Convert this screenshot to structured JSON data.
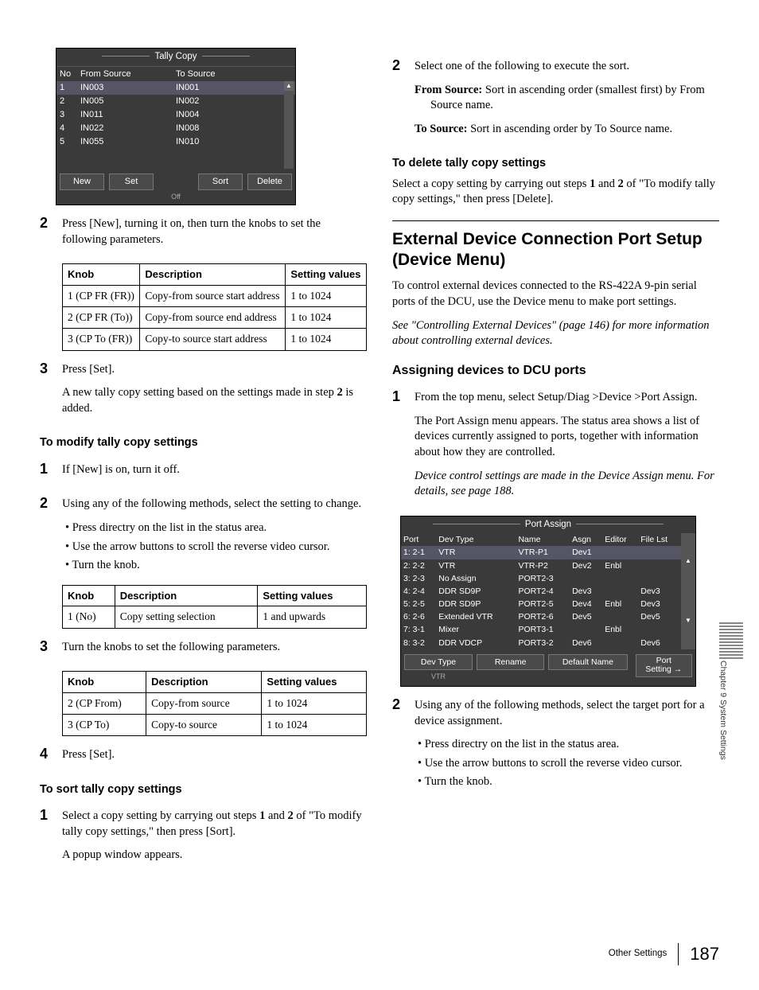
{
  "tally_panel": {
    "title": "Tally Copy",
    "headers": {
      "no": "No",
      "from": "From Source",
      "to": "To Source"
    },
    "rows": [
      {
        "no": "1",
        "from": "IN003",
        "to": "IN001"
      },
      {
        "no": "2",
        "from": "IN005",
        "to": "IN002"
      },
      {
        "no": "3",
        "from": "IN011",
        "to": "IN004"
      },
      {
        "no": "4",
        "from": "IN022",
        "to": "IN008"
      },
      {
        "no": "5",
        "from": "IN055",
        "to": "IN010"
      }
    ],
    "buttons": {
      "new": "New",
      "set": "Set",
      "sort": "Sort",
      "delete": "Delete"
    },
    "sub_off": "Off"
  },
  "left": {
    "step2a": "Press [New], turning it on, then turn the knobs to set the following parameters.",
    "table1": {
      "h1": "Knob",
      "h2": "Description",
      "h3": "Setting values",
      "r1": {
        "a": "1 (CP FR (FR))",
        "b": "Copy-from source start address",
        "c": "1 to 1024"
      },
      "r2": {
        "a": "2 (CP FR (To))",
        "b": "Copy-from source end address",
        "c": "1 to 1024"
      },
      "r3": {
        "a": "3 (CP To (FR))",
        "b": "Copy-to source start address",
        "c": "1 to 1024"
      }
    },
    "step3a": "Press [Set].",
    "step3b": "A new tally copy setting based on the settings made in step 2 is added.",
    "modify_h": "To modify tally copy settings",
    "mod1": "If [New] is on, turn it off.",
    "mod2": "Using any of the following methods, select the setting to change.",
    "mod2_a": "Press directry on the list in the status area.",
    "mod2_b": "Use the arrow buttons to scroll the reverse video cursor.",
    "mod2_c": "Turn the knob.",
    "table2": {
      "h1": "Knob",
      "h2": "Description",
      "h3": "Setting values",
      "r1": {
        "a": "1 (No)",
        "b": "Copy setting selection",
        "c": "1 and upwards"
      }
    },
    "mod3": "Turn the knobs to set the following parameters.",
    "table3": {
      "h1": "Knob",
      "h2": "Description",
      "h3": "Setting values",
      "r1": {
        "a": "2 (CP From)",
        "b": "Copy-from source",
        "c": "1 to 1024"
      },
      "r2": {
        "a": "3 (CP To)",
        "b": "Copy-to source",
        "c": "1 to 1024"
      }
    },
    "mod4": "Press [Set].",
    "sort_h": "To sort tally copy settings",
    "sort1": "Select a copy setting by carrying out steps 1 and 2 of \"To modify tally copy settings,\" then press [Sort].",
    "sort1b": "A popup window appears."
  },
  "right": {
    "step2": "Select one of the following to execute the sort.",
    "fs_label": "From Source:",
    "fs_text": " Sort in ascending order (smallest first) by From Source name.",
    "ts_label": "To Source:",
    "ts_text": " Sort in ascending order by To Source name.",
    "del_h": "To delete tally copy settings",
    "del_p": "Select a copy setting by carrying out steps 1 and 2 of \"To modify tally copy settings,\" then press [Delete].",
    "h2": "External Device Connection Port Setup (Device Menu)",
    "intro": "To control external devices connected to the RS-422A 9-pin serial ports of the DCU, use the Device menu to make port settings.",
    "see": "See \"Controlling External Devices\" (page 146) for more information about controlling external devices.",
    "h3": "Assigning devices to DCU ports",
    "a1": "From the top menu, select Setup/Diag >Device >Port Assign.",
    "a1b": "The Port Assign menu appears. The status area shows a list of devices currently assigned to ports, together with information about how they are controlled.",
    "a1c": "Device control settings are made in the Device Assign menu. For details, see page 188.",
    "a2": "Using any of the following methods, select the target port for a device assignment.",
    "a2a": "Press directry on the list in the status area.",
    "a2b": "Use the arrow buttons to scroll the reverse video cursor.",
    "a2c": "Turn the knob."
  },
  "port_panel": {
    "title": "Port Assign",
    "headers": {
      "port": "Port",
      "devtype": "Dev Type",
      "name": "Name",
      "asgn": "Asgn",
      "editor": "Editor",
      "filelst": "File Lst"
    },
    "rows": [
      {
        "port": "1: 2-1",
        "type": "VTR",
        "name": "VTR-P1",
        "asgn": "Dev1",
        "editor": "",
        "fl": ""
      },
      {
        "port": "2: 2-2",
        "type": "VTR",
        "name": "VTR-P2",
        "asgn": "Dev2",
        "editor": "Enbl",
        "fl": ""
      },
      {
        "port": "3: 2-3",
        "type": "No Assign",
        "name": "PORT2-3",
        "asgn": "",
        "editor": "",
        "fl": ""
      },
      {
        "port": "4: 2-4",
        "type": "DDR SD9P",
        "name": "PORT2-4",
        "asgn": "Dev3",
        "editor": "",
        "fl": "Dev3"
      },
      {
        "port": "5: 2-5",
        "type": "DDR SD9P",
        "name": "PORT2-5",
        "asgn": "Dev4",
        "editor": "Enbl",
        "fl": "Dev3"
      },
      {
        "port": "6: 2-6",
        "type": "Extended VTR",
        "name": "PORT2-6",
        "asgn": "Dev5",
        "editor": "",
        "fl": "Dev5"
      },
      {
        "port": "7: 3-1",
        "type": "Mixer",
        "name": "PORT3-1",
        "asgn": "",
        "editor": "Enbl",
        "fl": ""
      },
      {
        "port": "8: 3-2",
        "type": "DDR VDCP",
        "name": "PORT3-2",
        "asgn": "Dev6",
        "editor": "",
        "fl": "Dev6"
      }
    ],
    "buttons": {
      "devtype": "Dev Type",
      "rename": "Rename",
      "default": "Default Name",
      "portsetting": "Port Setting"
    },
    "sub_vtr": "VTR"
  },
  "margin": {
    "chapter": "Chapter 9  System Settings",
    "section": "Other Settings",
    "page": "187"
  }
}
